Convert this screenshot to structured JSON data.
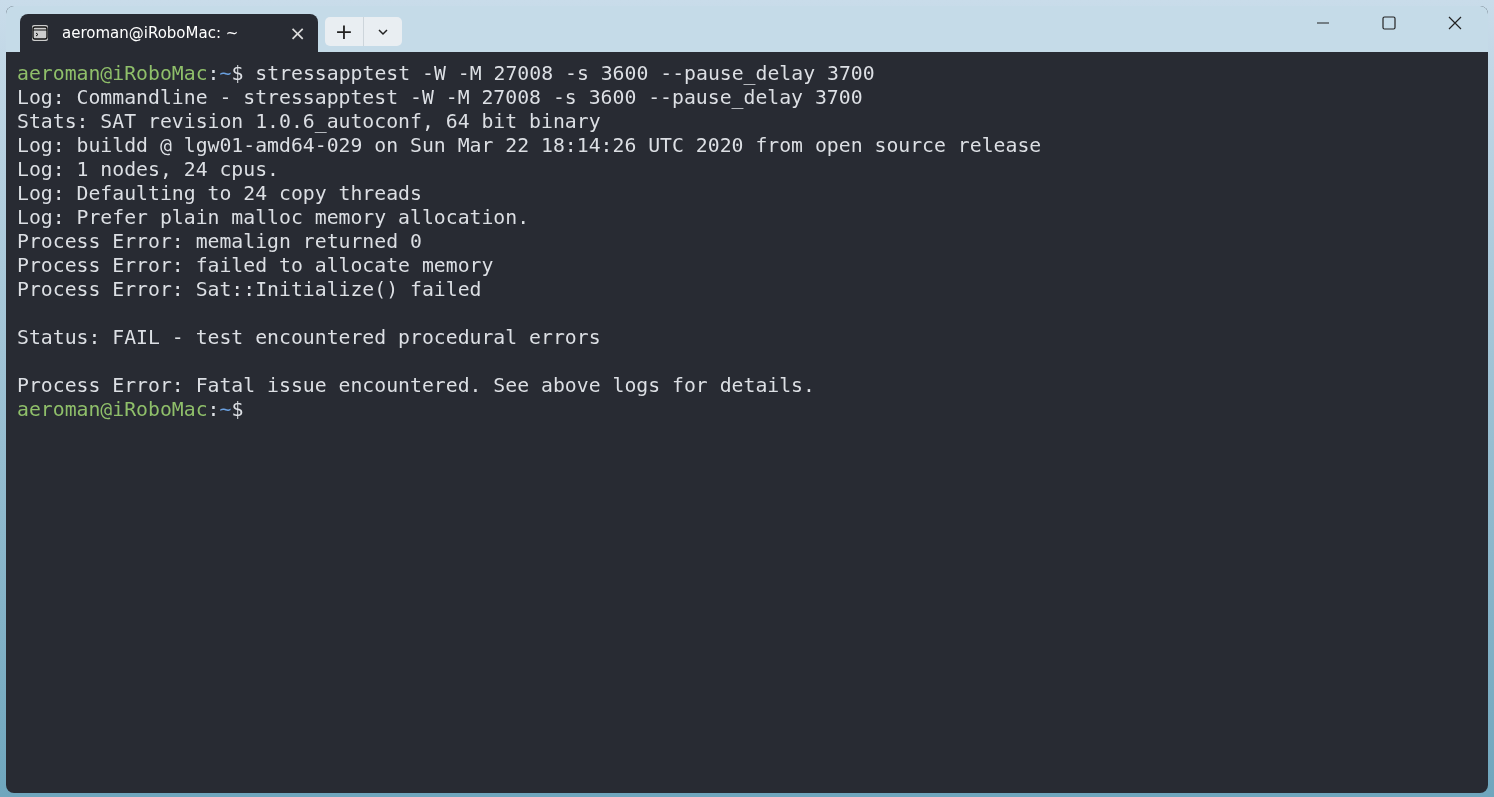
{
  "tabs": [
    {
      "title": "aeroman@iRoboMac: ~",
      "selected": true,
      "close": "×"
    }
  ],
  "new_tab": "+",
  "terminal": {
    "lines": [
      {
        "kind": "prompt",
        "user": "aeroman@iRoboMac",
        "separator": ":",
        "path": "~",
        "symbol": "$",
        "command": "stressapptest -W -M 27008 -s 3600 --pause_delay 3700"
      },
      {
        "kind": "output",
        "text": "Log: Commandline - stressapptest -W -M 27008 -s 3600 --pause_delay 3700"
      },
      {
        "kind": "output",
        "text": "Stats: SAT revision 1.0.6_autoconf, 64 bit binary"
      },
      {
        "kind": "output",
        "text": "Log: buildd @ lgw01-amd64-029 on Sun Mar 22 18:14:26 UTC 2020 from open source release"
      },
      {
        "kind": "output",
        "text": "Log: 1 nodes, 24 cpus."
      },
      {
        "kind": "output",
        "text": "Log: Defaulting to 24 copy threads"
      },
      {
        "kind": "output",
        "text": "Log: Prefer plain malloc memory allocation."
      },
      {
        "kind": "output",
        "text": "Process Error: memalign returned 0"
      },
      {
        "kind": "output",
        "text": "Process Error: failed to allocate memory"
      },
      {
        "kind": "output",
        "text": "Process Error: Sat::Initialize() failed"
      },
      {
        "kind": "blank"
      },
      {
        "kind": "output",
        "text": "Status: FAIL - test encountered procedural errors"
      },
      {
        "kind": "blank"
      },
      {
        "kind": "output",
        "text": "Process Error: Fatal issue encountered. See above logs for details."
      },
      {
        "kind": "prompt",
        "user": "aeroman@iRoboMac",
        "separator": ":",
        "path": "~",
        "symbol": "$"
      }
    ]
  }
}
